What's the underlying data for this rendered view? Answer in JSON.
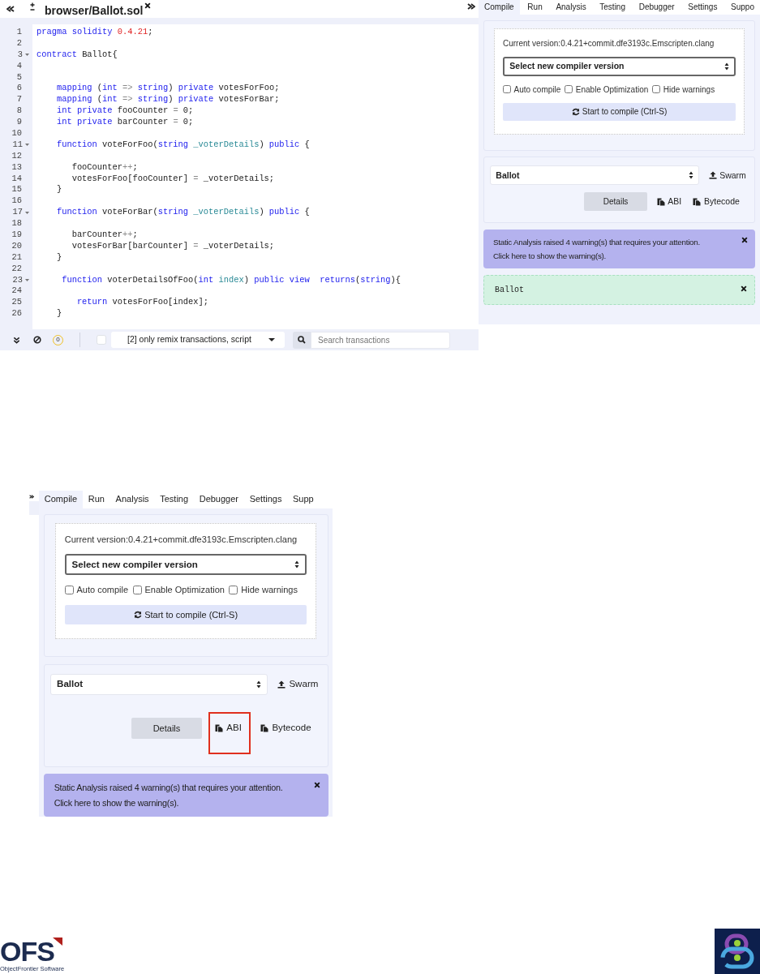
{
  "editor": {
    "file_tab": {
      "label": "browser/Ballot.sol"
    },
    "lines": [
      {
        "number": "1",
        "foldable": false,
        "segments": [
          {
            "text": "pragma",
            "kind": "keyword"
          },
          {
            "text": " solidity",
            "kind": "keyword"
          },
          {
            "text": " 0.4.21",
            "kind": "number"
          },
          {
            "text": ";",
            "kind": "plain"
          }
        ]
      },
      {
        "number": "2",
        "foldable": false
      },
      {
        "number": "3",
        "foldable": true,
        "segments": [
          {
            "text": "contract",
            "kind": "keyword"
          },
          {
            "text": " Ballot{",
            "kind": "plain"
          }
        ]
      },
      {
        "number": "4",
        "foldable": false
      },
      {
        "number": "5",
        "foldable": false
      },
      {
        "number": "6",
        "foldable": false,
        "segments": [
          {
            "text": "    mapping",
            "kind": "keyword"
          },
          {
            "text": " (",
            "kind": "plain"
          },
          {
            "text": "int",
            "kind": "keyword"
          },
          {
            "text": " =>",
            "kind": "operator"
          },
          {
            "text": " string",
            "kind": "keyword"
          },
          {
            "text": ") ",
            "kind": "plain"
          },
          {
            "text": "private",
            "kind": "keyword"
          },
          {
            "text": " votesForFoo;",
            "kind": "plain"
          }
        ]
      },
      {
        "number": "7",
        "foldable": false,
        "segments": [
          {
            "text": "    mapping",
            "kind": "keyword"
          },
          {
            "text": " (",
            "kind": "plain"
          },
          {
            "text": "int",
            "kind": "keyword"
          },
          {
            "text": " =>",
            "kind": "operator"
          },
          {
            "text": " string",
            "kind": "keyword"
          },
          {
            "text": ") ",
            "kind": "plain"
          },
          {
            "text": "private",
            "kind": "keyword"
          },
          {
            "text": " votesForBar;",
            "kind": "plain"
          }
        ]
      },
      {
        "number": "8",
        "foldable": false,
        "segments": [
          {
            "text": "    int",
            "kind": "keyword"
          },
          {
            "text": " private",
            "kind": "keyword"
          },
          {
            "text": " fooCounter ",
            "kind": "plain"
          },
          {
            "text": "=",
            "kind": "operator"
          },
          {
            "text": " 0;",
            "kind": "plain"
          }
        ]
      },
      {
        "number": "9",
        "foldable": false,
        "segments": [
          {
            "text": "    int",
            "kind": "keyword"
          },
          {
            "text": " private",
            "kind": "keyword"
          },
          {
            "text": " barCounter ",
            "kind": "plain"
          },
          {
            "text": "=",
            "kind": "operator"
          },
          {
            "text": " 0;",
            "kind": "plain"
          }
        ]
      },
      {
        "number": "10",
        "foldable": false
      },
      {
        "number": "11",
        "foldable": true,
        "segments": [
          {
            "text": "    function",
            "kind": "keyword"
          },
          {
            "text": " voteForFoo(",
            "kind": "plain"
          },
          {
            "text": "string",
            "kind": "keyword"
          },
          {
            "text": " _voterDetails",
            "kind": "param"
          },
          {
            "text": ") ",
            "kind": "plain"
          },
          {
            "text": "public",
            "kind": "keyword"
          },
          {
            "text": " {",
            "kind": "plain"
          }
        ]
      },
      {
        "number": "12",
        "foldable": false
      },
      {
        "number": "13",
        "foldable": false,
        "segments": [
          {
            "text": "       fooCounter",
            "kind": "plain"
          },
          {
            "text": "++",
            "kind": "operator"
          },
          {
            "text": ";",
            "kind": "plain"
          }
        ]
      },
      {
        "number": "14",
        "foldable": false,
        "segments": [
          {
            "text": "       votesForFoo[fooCounter] ",
            "kind": "plain"
          },
          {
            "text": "=",
            "kind": "operator"
          },
          {
            "text": " _voterDetails;",
            "kind": "plain"
          }
        ]
      },
      {
        "number": "15",
        "foldable": false,
        "segments": [
          {
            "text": "    }",
            "kind": "plain"
          }
        ]
      },
      {
        "number": "16",
        "foldable": false
      },
      {
        "number": "17",
        "foldable": true,
        "segments": [
          {
            "text": "    function",
            "kind": "keyword"
          },
          {
            "text": " voteForBar(",
            "kind": "plain"
          },
          {
            "text": "string",
            "kind": "keyword"
          },
          {
            "text": " _voterDetails",
            "kind": "param"
          },
          {
            "text": ") ",
            "kind": "plain"
          },
          {
            "text": "public",
            "kind": "keyword"
          },
          {
            "text": " {",
            "kind": "plain"
          }
        ]
      },
      {
        "number": "18",
        "foldable": false
      },
      {
        "number": "19",
        "foldable": false,
        "segments": [
          {
            "text": "       barCounter",
            "kind": "plain"
          },
          {
            "text": "++",
            "kind": "operator"
          },
          {
            "text": ";",
            "kind": "plain"
          }
        ]
      },
      {
        "number": "20",
        "foldable": false,
        "segments": [
          {
            "text": "       votesForBar[barCounter] ",
            "kind": "plain"
          },
          {
            "text": "=",
            "kind": "operator"
          },
          {
            "text": " _voterDetails;",
            "kind": "plain"
          }
        ]
      },
      {
        "number": "21",
        "foldable": false,
        "segments": [
          {
            "text": "    }",
            "kind": "plain"
          }
        ]
      },
      {
        "number": "22",
        "foldable": false
      },
      {
        "number": "23",
        "foldable": true,
        "segments": [
          {
            "text": "     function",
            "kind": "keyword"
          },
          {
            "text": " voterDetailsOfFoo(",
            "kind": "plain"
          },
          {
            "text": "int",
            "kind": "keyword"
          },
          {
            "text": " index",
            "kind": "param"
          },
          {
            "text": ") ",
            "kind": "plain"
          },
          {
            "text": "public",
            "kind": "keyword"
          },
          {
            "text": " view",
            "kind": "keyword"
          },
          {
            "text": "  returns",
            "kind": "keyword"
          },
          {
            "text": "(",
            "kind": "plain"
          },
          {
            "text": "string",
            "kind": "keyword"
          },
          {
            "text": "){",
            "kind": "plain"
          }
        ]
      },
      {
        "number": "24",
        "foldable": false
      },
      {
        "number": "25",
        "foldable": false,
        "segments": [
          {
            "text": "        return",
            "kind": "keyword"
          },
          {
            "text": " votesForFoo[index];",
            "kind": "plain"
          }
        ]
      },
      {
        "number": "26",
        "foldable": false,
        "segments": [
          {
            "text": "    }",
            "kind": "plain"
          }
        ]
      }
    ]
  },
  "terminal": {
    "pending_count": "0",
    "filter_checked": false,
    "filter_select": "[2] only remix transactions, script",
    "search": {
      "placeholder": "Search transactions"
    }
  },
  "panels": [
    {
      "side_toggle": false,
      "tabs": [
        {
          "label": "Compile",
          "selected": true
        },
        {
          "label": "Run",
          "selected": false
        },
        {
          "label": "Analysis",
          "selected": false
        },
        {
          "label": "Testing",
          "selected": false
        },
        {
          "label": "Debugger",
          "selected": false
        },
        {
          "label": "Settings",
          "selected": false
        },
        {
          "label": "Suppo",
          "selected": false
        }
      ],
      "current_version": "Current version:0.4.21+commit.dfe3193c.Emscripten.clang",
      "compiler_select": "Select new compiler version",
      "options": [
        {
          "label": "Auto compile",
          "checked": false
        },
        {
          "label": "Enable Optimization",
          "checked": false
        },
        {
          "label": "Hide warnings",
          "checked": false
        }
      ],
      "compile_button": "Start to compile (Ctrl-S)",
      "contract_select": "Ballot",
      "swarm_button": "Swarm",
      "details_button": "Details",
      "copy_buttons": [
        {
          "label": "ABI",
          "highlighted": false
        },
        {
          "label": "Bytecode",
          "highlighted": false
        }
      ],
      "warning_lines": [
        "Static Analysis raised 4 warning(s) that requires your attention.",
        "Click here to show the warning(s)."
      ],
      "result": "Ballot"
    },
    {
      "side_toggle": true,
      "tabs": [
        {
          "label": "Compile",
          "selected": true
        },
        {
          "label": "Run",
          "selected": false
        },
        {
          "label": "Analysis",
          "selected": false
        },
        {
          "label": "Testing",
          "selected": false
        },
        {
          "label": "Debugger",
          "selected": false
        },
        {
          "label": "Settings",
          "selected": false
        },
        {
          "label": "Supp",
          "selected": false
        }
      ],
      "current_version": "Current version:0.4.21+commit.dfe3193c.Emscripten.clang",
      "compiler_select": "Select new compiler version",
      "options": [
        {
          "label": "Auto compile",
          "checked": false
        },
        {
          "label": "Enable Optimization",
          "checked": false
        },
        {
          "label": "Hide warnings",
          "checked": false
        }
      ],
      "compile_button": "Start to compile (Ctrl-S)",
      "contract_select": "Ballot",
      "swarm_button": "Swarm",
      "details_button": "Details",
      "copy_buttons": [
        {
          "label": "ABI",
          "highlighted": true
        },
        {
          "label": "Bytecode",
          "highlighted": false
        }
      ],
      "warning_lines": [
        "Static Analysis raised 4 warning(s) that requires your attention.",
        "Click here to show the warning(s)."
      ]
    }
  ],
  "footer": {
    "company_logo": {
      "wordmark": "OFS",
      "tagline": "ObjectFrontier Software"
    }
  }
}
